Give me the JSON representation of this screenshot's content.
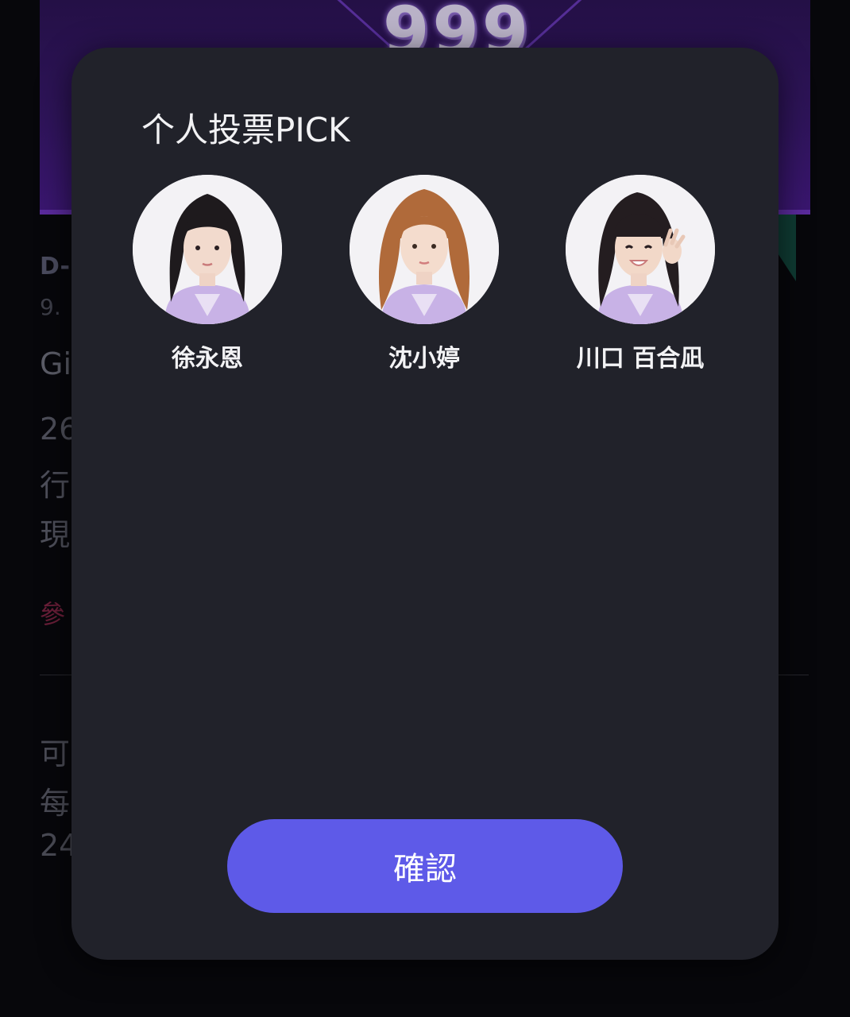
{
  "background": {
    "banner_logo": "999",
    "countdown_prefix": "D-",
    "date_prefix": "9.",
    "heading_prefix": "Gi",
    "paragraph_1": [
      "26",
      "行",
      "現"
    ],
    "link_prefix": "參",
    "paragraph_2": [
      "可",
      "每",
      "24"
    ]
  },
  "modal": {
    "title": "个人投票PICK",
    "picks": [
      {
        "name": "徐永恩",
        "icon": "avatar-photo",
        "hair_color": "#1e1a1d"
      },
      {
        "name": "沈小婷",
        "icon": "avatar-photo",
        "hair_color": "#b06a3a"
      },
      {
        "name": "川口 百合凪",
        "icon": "avatar-photo",
        "hair_color": "#241d20"
      }
    ],
    "confirm_label": "確認"
  },
  "colors": {
    "modal_bg": "#21222a",
    "confirm_bg": "#5e5ae8",
    "banner_bg": "#2e1459",
    "uniform": "#c8b2e6"
  }
}
